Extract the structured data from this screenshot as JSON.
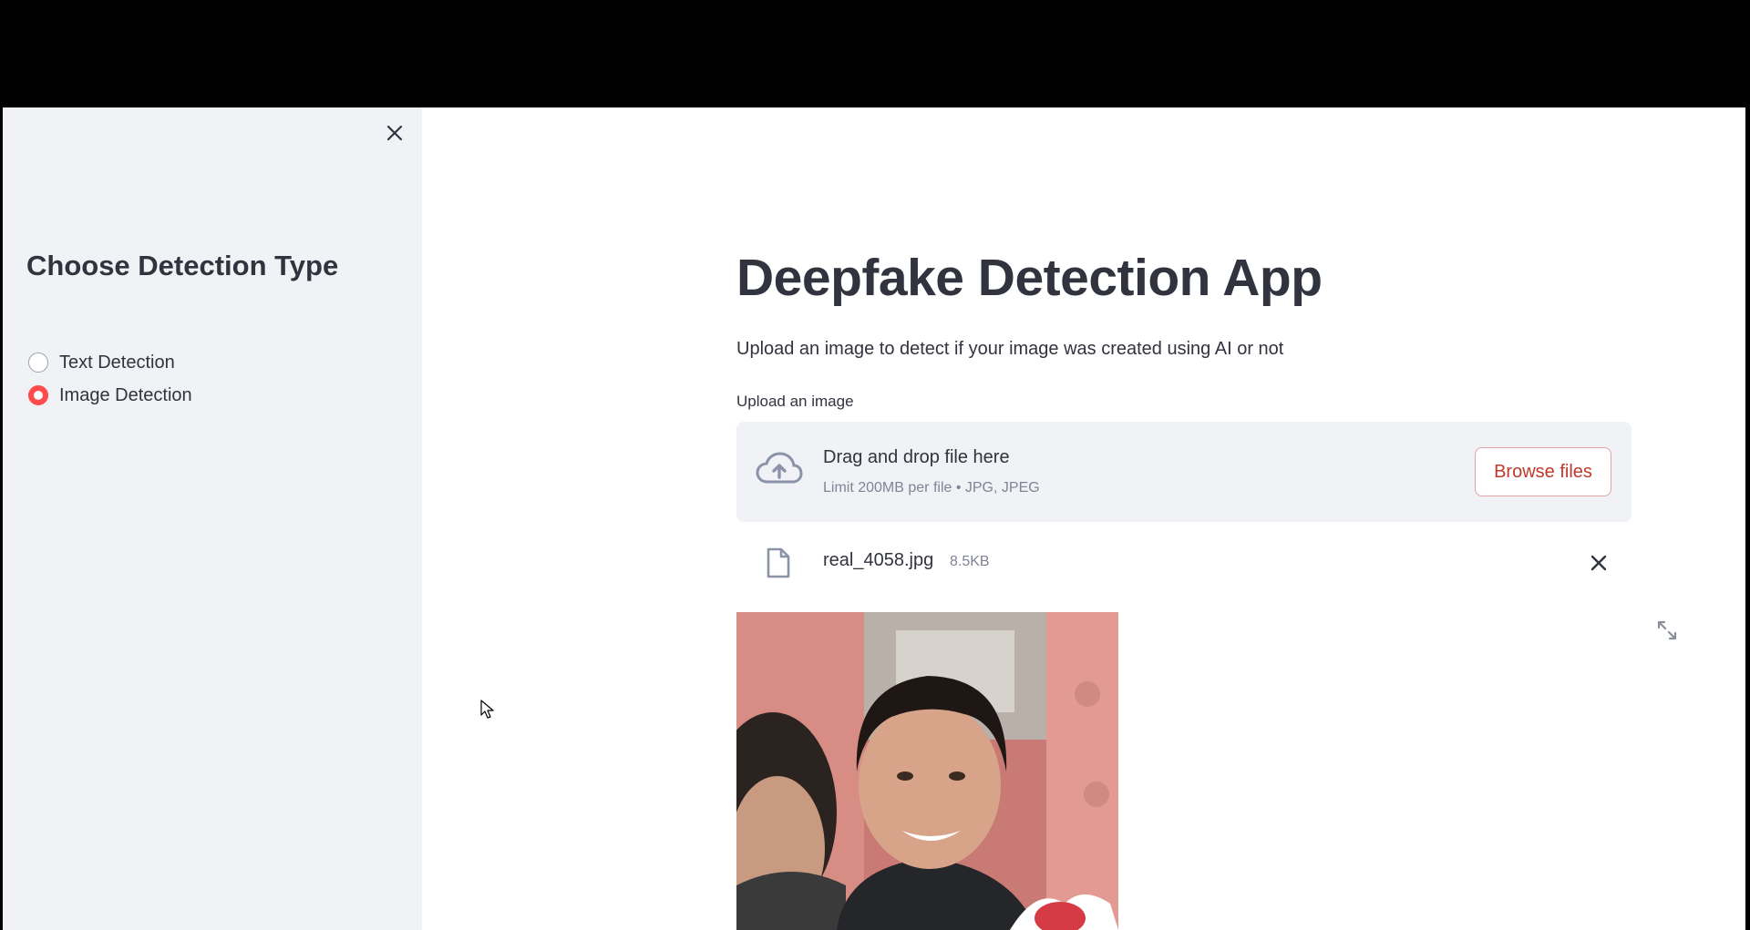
{
  "sidebar": {
    "title": "Choose Detection Type",
    "options": [
      {
        "label": "Text Detection",
        "selected": false
      },
      {
        "label": "Image Detection",
        "selected": true
      }
    ],
    "close_icon": "close-icon"
  },
  "main": {
    "title": "Deepfake Detection App",
    "subtitle": "Upload an image to detect if your image was created using AI or not",
    "uploader": {
      "label": "Upload an image",
      "drop_text": "Drag and drop file here",
      "limit_text": "Limit 200MB per file • JPG, JPEG",
      "browse_label": "Browse files",
      "icon": "cloud-upload-icon"
    },
    "file": {
      "name": "real_4058.jpg",
      "size": "8.5KB",
      "icon": "file-icon"
    }
  },
  "colors": {
    "accent": "#ff4b4b",
    "sidebar_bg": "#f0f2f6",
    "text": "#31333f",
    "muted": "#808495"
  }
}
